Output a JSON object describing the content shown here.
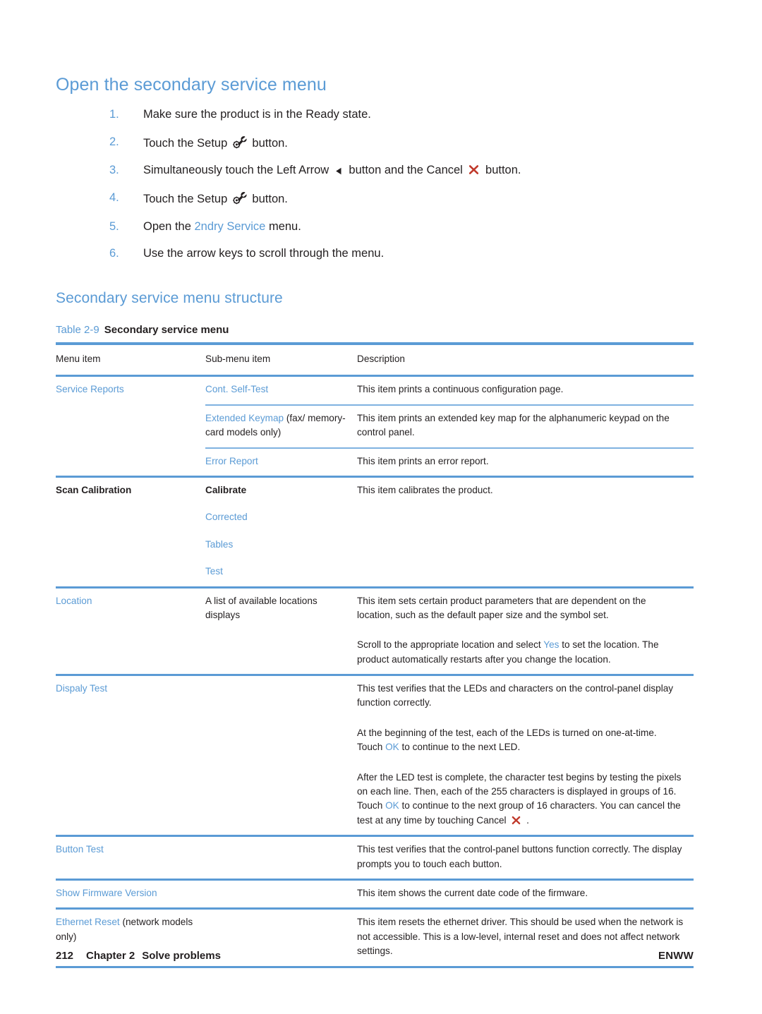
{
  "document": {
    "heading1": "Open the secondary service menu",
    "heading2": "Secondary service menu structure"
  },
  "steps": [
    {
      "num": "1.",
      "pre": "Make sure the product is in the Ready state.",
      "icon": "",
      "post": "",
      "link": ""
    },
    {
      "num": "2.",
      "pre": "Touch the Setup ",
      "icon": "setup-wrench-icon",
      "post": " button.",
      "link": ""
    },
    {
      "num": "3.",
      "pre": "Simultaneously touch the Left Arrow ",
      "icon": "left-arrow-icon",
      "mid": " button and the Cancel ",
      "icon2": "cancel-x-icon",
      "post": " button.",
      "link": ""
    },
    {
      "num": "4.",
      "pre": "Touch the Setup ",
      "icon": "setup-wrench-icon",
      "post": " button.",
      "link": ""
    },
    {
      "num": "5.",
      "pre": "Open the ",
      "link": "2ndry Service",
      "post": " menu.",
      "icon": ""
    },
    {
      "num": "6.",
      "pre": "Use the arrow keys to scroll through the menu.",
      "icon": "",
      "post": "",
      "link": ""
    }
  ],
  "table": {
    "caption_label": "Table 2-9",
    "caption_title": "Secondary service menu",
    "headers": [
      "Menu item",
      "Sub-menu item",
      "Description"
    ],
    "rows": [
      {
        "menu": "Service Reports",
        "menu_style": "link",
        "sub": "Cont. Self-Test",
        "sub_style": "link",
        "desc": [
          "This item prints a continuous configuration page."
        ]
      },
      {
        "menu": "",
        "sub_link": "Extended Keymap",
        "sub_plain": " (fax/ memory-card models only)",
        "desc": [
          "This item prints an extended key map for the alphanumeric keypad on the control panel."
        ]
      },
      {
        "menu": "",
        "sub": "Error Report",
        "sub_style": "link",
        "desc": [
          "This item prints an error report."
        ]
      },
      {
        "menu": "Scan Calibration",
        "menu_style": "bold",
        "sub": "Calibrate",
        "sub_style": "bold",
        "desc": [
          "This item calibrates the product."
        ]
      },
      {
        "menu": "",
        "sub": "Corrected",
        "sub_style": "link",
        "desc": []
      },
      {
        "menu": "",
        "sub": "Tables",
        "sub_style": "link",
        "desc": []
      },
      {
        "menu": "",
        "sub": "Test",
        "sub_style": "link",
        "desc": []
      },
      {
        "menu": "Location",
        "menu_style": "link",
        "sub": "A list of available locations displays",
        "sub_style": "plain",
        "desc_parts": [
          {
            "pre": "This item sets certain product parameters that are dependent on the location, such as the default paper size and the symbol set.",
            "link": "",
            "post": ""
          },
          {
            "pre": "Scroll to the appropriate location and select ",
            "link": "Yes",
            "post": " to set the location. The product automatically restarts after you change the location."
          }
        ]
      },
      {
        "menu": "Dispaly Test",
        "menu_style": "link",
        "sub": "",
        "desc_parts": [
          {
            "pre": "This test verifies that the LEDs and characters on the control-panel display function correctly.",
            "link": "",
            "post": ""
          },
          {
            "pre": "At the beginning of the test, each of the LEDs is turned on one-at-time. Touch ",
            "link": "OK",
            "post": " to continue to the next LED."
          },
          {
            "pre": "After the LED test is complete, the character test begins by testing the pixels on each line. Then, each of the 255 characters is displayed in groups of 16. Touch ",
            "link": "OK",
            "mid": " to continue to the next group of 16 characters. You can cancel the test at any time by touching Cancel ",
            "icon": "cancel-x-icon",
            "post": " ."
          }
        ]
      },
      {
        "menu": "Button Test",
        "menu_style": "link",
        "sub": "",
        "desc": [
          "This test verifies that the control-panel buttons function correctly. The display prompts you to touch each button."
        ]
      },
      {
        "menu": "Show Firmware Version",
        "menu_style": "link",
        "sub": "",
        "desc": [
          "This item shows the current date code of the firmware."
        ]
      },
      {
        "menu_link": "Ethernet Reset",
        "menu_plain": " (network models only)",
        "sub": "",
        "desc": [
          "This item resets the ethernet driver. This should be used when the network is not accessible. This is a low-level, internal reset and does not affect network settings."
        ]
      }
    ]
  },
  "footer": {
    "page_number": "212",
    "chapter": "Chapter 2",
    "chapter_title": "Solve problems",
    "right": "ENWW"
  },
  "colors": {
    "accent_blue": "#5b9bd5",
    "rule_blue": "#5b9bd5",
    "minor_rule_blue": "#7fb2e0",
    "cancel_red": "#c0392b",
    "text": "#231f20"
  }
}
